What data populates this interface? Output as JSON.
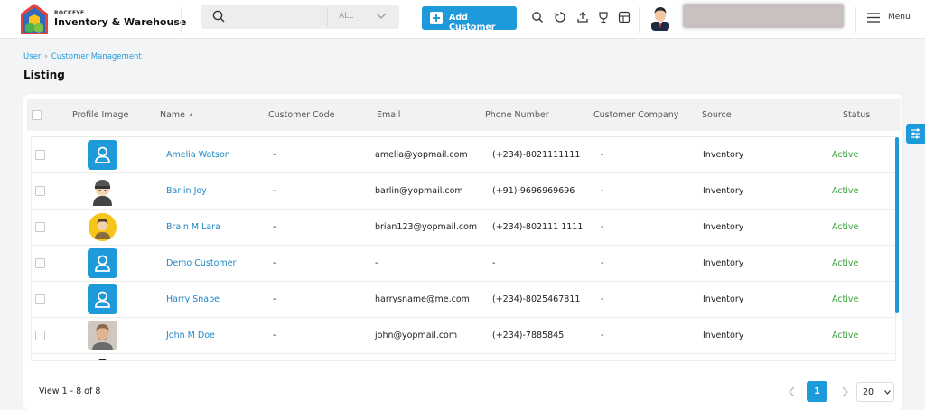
{
  "header": {
    "brand_small": "ROCKEYE",
    "brand_big": "Inventory & Warehouse",
    "search_placeholder": "",
    "search_scope": "ALL",
    "add_customer_label": "Add Customer",
    "menu_label": "Menu",
    "icons": [
      "search-icon",
      "refresh-icon",
      "upload-icon",
      "trophy-icon",
      "layout-icon"
    ]
  },
  "breadcrumb": {
    "items": [
      "User",
      "Customer Management"
    ]
  },
  "page_title": "Listing",
  "table": {
    "columns": [
      "Profile Image",
      "Name",
      "Customer Code",
      "Email",
      "Phone Number",
      "Customer Company",
      "Source",
      "Status"
    ],
    "rows": [
      {
        "avatar": "default-user-icon",
        "name": "Amelia Watson",
        "code": "-",
        "email": "amelia@yopmail.com",
        "phone": "(+234)-8021111111",
        "company": "-",
        "source": "Inventory",
        "status": "Active"
      },
      {
        "avatar": "ninja-avatar",
        "name": "Barlin Joy",
        "code": "-",
        "email": "barlin@yopmail.com",
        "phone": "(+91)-9696969696",
        "company": "-",
        "source": "Inventory",
        "status": "Active"
      },
      {
        "avatar": "man-avatar",
        "name": "Brain M Lara",
        "code": "-",
        "email": "brian123@yopmail.com",
        "phone": "(+234)-802111 1111",
        "company": "-",
        "source": "Inventory",
        "status": "Active"
      },
      {
        "avatar": "default-user-icon",
        "name": "Demo Customer",
        "code": "-",
        "email": "-",
        "phone": "-",
        "company": "-",
        "source": "Inventory",
        "status": "Active"
      },
      {
        "avatar": "default-user-icon",
        "name": "Harry Snape",
        "code": "-",
        "email": "harrysname@me.com",
        "phone": "(+234)-8025467811",
        "company": "-",
        "source": "Inventory",
        "status": "Active"
      },
      {
        "avatar": "photo-avatar",
        "name": "John M Doe",
        "code": "-",
        "email": "john@yopmail.com",
        "phone": "(+234)-7885845",
        "company": "-",
        "source": "Inventory",
        "status": "Active"
      }
    ]
  },
  "footer": {
    "view_count": "View 1 - 8 of 8",
    "current_page": "1",
    "per_page": "20"
  },
  "colors": {
    "accent": "#1e9adb",
    "link": "#1e88c8",
    "active": "#3aa33a"
  }
}
